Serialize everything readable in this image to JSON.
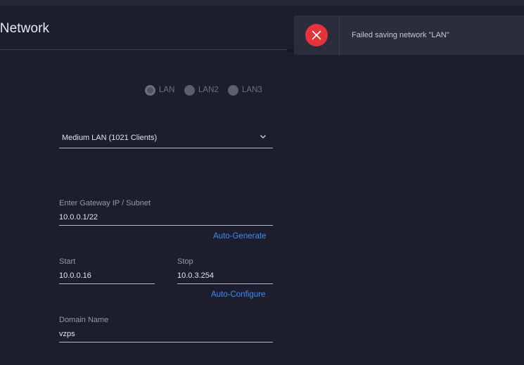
{
  "header": {
    "title": "t Network"
  },
  "radios": [
    {
      "label": "LAN",
      "selected": true
    },
    {
      "label": "LAN2",
      "selected": false
    },
    {
      "label": "LAN3",
      "selected": false
    }
  ],
  "network_size": {
    "value": "Medium LAN (1021 Clients)"
  },
  "gateway": {
    "label": "Enter Gateway IP / Subnet",
    "value": "10.0.0.1/22",
    "auto_generate_label": "Auto-Generate"
  },
  "dhcp_range": {
    "start_label": "Start",
    "start_value": "10.0.0.16",
    "stop_label": "Stop",
    "stop_value": "10.0.3.254",
    "auto_configure_label": "Auto-Configure"
  },
  "domain": {
    "label": "Domain Name",
    "value": "vzps"
  },
  "toast": {
    "message": "Failed saving network \"LAN\"",
    "icon": "error-icon",
    "color": "#e5333c"
  },
  "colors": {
    "background": "#1c1e2d",
    "accent_link": "#3f8cf4",
    "error": "#e5333c"
  }
}
